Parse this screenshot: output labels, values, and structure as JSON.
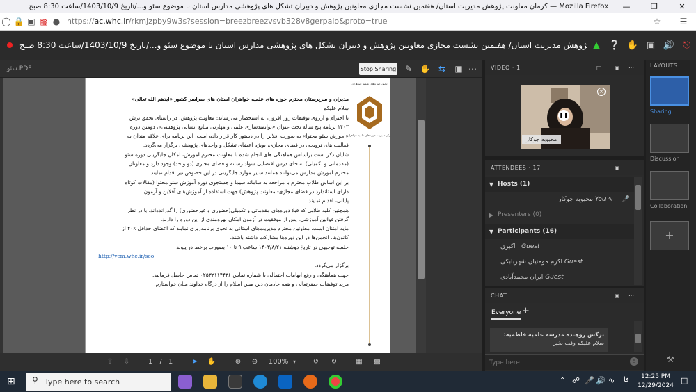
{
  "browser": {
    "window_title": "کرمان معاونت پژوهش مدیریت استان/ هفتمین نشست مجازی معاونین پژوهش و دبیران تشکل های پژوهشی مدارس استان با موضوع سئو و.../تاریخ 1403/10/9/ساعت 8:30 صبح — Mozilla Firefox",
    "url_prefix": "https://",
    "url_host": "ac.whc.ir",
    "url_rest": "/rkmjzpby9w3s?session=breezbreezvsvb328v8gerpaio&proto=true"
  },
  "meeting": {
    "title": "کرمان معاونت پژوهش مدیریت استان/ هفتمین نشست مجازی معاونین پژوهش و دبیران تشکل های پژوهشی مدارس استان با موضوع سئو و.../تاریخ 1403/10/9/ساعت 8:30 صبح"
  },
  "share": {
    "file_name": "سئو.PDF",
    "stop_label": "Stop Sharing",
    "page_current": "1",
    "page_sep": "/",
    "page_total": "1",
    "zoom": "100%"
  },
  "document": {
    "lines": [
      "مدیران و سرپرستان محترم حوزه های علمیه خواهران استان های  سراسر کشور «ایدهم الله تعالی»",
      "",
      "سلام علیکم",
      "با احترام و آرزوی توفیقات روز افزون، به استحضار می‌رساند: معاونت پژوهش، در راستای تحقق برش",
      "۱۴۰۳ برنامه پنج ساله تحت عنوان «توانمندسازی علمی و مهارتی منابع انسانی پژوهشی»، دومین دوره",
      "«آموزش سئو محتوا» به صورت آفلاین را در دستور کار قرار داده است. این برنامه برای علاقه مندان به",
      "فعالیت های ترویجی در فضای مجازی، بویژه اعضای تشکل و واحدهای پژوهشی برگزار می‌گردد.",
      "شایان ذکر است براساس هماهنگی های انجام شده با معاونت محترم آموزش، امکان جایگزینی دوره سئو",
      "(مقدماتی و تکمیلی) به جای درس اقتضایی سواد رسانه و فضای مجازی (دو واحد) وجود دارد و معاونان",
      "محترم آموزش مدارس می‌توانند همانند سایر موارد جایگزینی در این خصوص نیز اقدام نمایند.",
      "بر این اساس طلاب محترم با مراجعه به سامانه سیما و جستجوی دوره آموزش سئو محتوا (مقالات کوتاه",
      "دارای استاندارد در فضای مجازی- معاونت پژوهش) جهت استفاده از آموزش‌های آفلاین و آزمون",
      "پایانی، اقدام نمایند.",
      "همچنین کلیه طلابی که قبلا دوره‌های مقدماتی و تکمیلی(حضوری و غیرحضوری) را گذرانده‌اند، با در نظر",
      "گرفتن قوانین آموزشی، پس از موفقیت در آزمون امکان بهره‌مندی از این دوره را دارند.",
      "مایه امتنان است، معاونین محترم مدیریت‌های استانی به نحوی برنامه‌ریزی نمایند که اعضای حداقل ٪۴۰ از",
      "کانون‌ها، انجمن‌ها در این دوره‌ها مشارکت داشته باشند.",
      "جلسه توجیهی در تاریخ دوشنبه ۱۴۰۳/۸/۲۱ ساعت ۹ تا ۱۰ بصورت برخط در پیوند",
      "برگزار می‌گردد.",
      "جهت هماهنگی و رفع ابهامات احتمالی با شماره تماس ۰۲۵۳۲۱۱۴۴۳۶ تماس حاصل فرمایید.",
      "مزید توفیقات حضرتعالی و همه خادمان دین مبین اسلام را از درگاه خداوند منان خواستارم."
    ],
    "link": "http://vcm.whc.ir/seo"
  },
  "video": {
    "pod_title": "VIDEO",
    "pod_count": "· 1",
    "participant_name": "محبوبه جوکار"
  },
  "attendees": {
    "pod_title": "ATTENDEES",
    "pod_count": "· 17",
    "hosts_label": "Hosts (1)",
    "host_name": "محبوبه جوکار",
    "host_tag": "You",
    "presenters_label": "Presenters (0)",
    "participants_label": "Participants (16)",
    "participants": [
      {
        "name": "اکبری",
        "tag": "Guest"
      },
      {
        "name": "اکرم مومنیان شهربابکی",
        "tag": "Guest"
      },
      {
        "name": "ایران محمدآبادی",
        "tag": "Guest"
      }
    ]
  },
  "chat": {
    "pod_title": "CHAT",
    "tab_label": "Everyone",
    "message_author": "نرگس روهنده مدرسه علمیه فاطمیه:",
    "message_text": "سلام علیکم وقت بخیر",
    "input_placeholder": "Type here"
  },
  "layouts": {
    "title": "LAYOUTS",
    "items": [
      "Sharing",
      "Discussion",
      "Collaboration"
    ]
  },
  "taskbar": {
    "search_placeholder": "Type here to search",
    "lang": "فا",
    "time": "12:25 PM",
    "date": "12/29/2024"
  }
}
